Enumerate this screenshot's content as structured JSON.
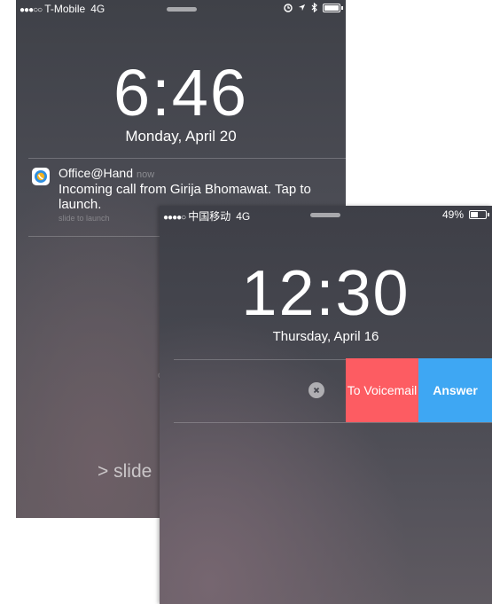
{
  "screen1": {
    "status": {
      "signal": "●●●○○",
      "carrier": "T-Mobile",
      "network": "4G"
    },
    "time": "6:46",
    "date": "Monday, April 20",
    "notification": {
      "app": "Office@Hand",
      "age": "now",
      "message": "Incoming call from Girija Bhomawat. Tap to launch.",
      "slide_hint": "slide to launch"
    },
    "slide_text": "slide",
    "slide_chevron": ">",
    "stray_text": "o"
  },
  "screen2": {
    "status": {
      "signal": "●●●●○",
      "carrier": "中国移动",
      "network": "4G",
      "battery": "49%",
      "battery_level": 0.49
    },
    "time": "12:30",
    "date": "Thursday, April 16",
    "voicemail_label": "To Voicemail",
    "answer_label": "Answer"
  },
  "icons": [
    "alarm-icon",
    "location-arrow-icon",
    "bluetooth-icon",
    "battery-icon",
    "clear-icon",
    "app-icon"
  ],
  "colors": {
    "voicemail": "#fd5c62",
    "answer": "#3ea7f3"
  }
}
